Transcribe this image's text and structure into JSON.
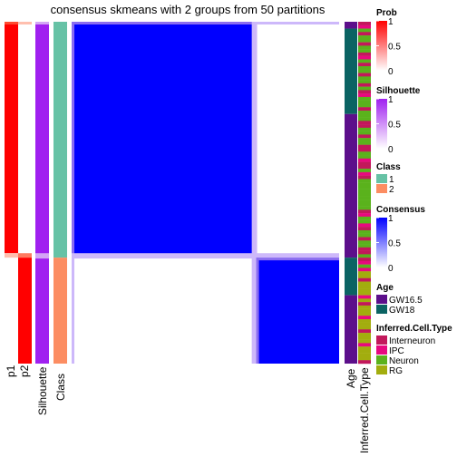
{
  "chart_data": {
    "type": "heatmap",
    "title": "consensus skmeans with 2 groups from 50 partitions",
    "n_samples": 100,
    "group_sizes": [
      69,
      31
    ],
    "columns": [
      "p1",
      "p2",
      "Silhouette",
      "Class"
    ],
    "right_annotations": [
      "Age",
      "Inferred.Cell.Type"
    ],
    "groups": [
      {
        "class": "1",
        "p1": 1.0,
        "p2": 0.0,
        "silhouette": 0.92,
        "consensus_within": 1.0,
        "consensus_between": 0.0
      },
      {
        "class": "2",
        "p1": 0.0,
        "p2": 1.0,
        "silhouette": 0.92,
        "consensus_within": 1.0,
        "consensus_between": 0.0
      }
    ],
    "boundary_values": {
      "p1_edge": 0.25,
      "p2_edge": 0.75,
      "silhouette_edge": 0.5,
      "consensus_edge": 0.35
    },
    "age_segments": [
      {
        "label": "GW16.5",
        "count": 2
      },
      {
        "label": "GW18",
        "count": 25
      },
      {
        "label": "GW16.5",
        "count": 42
      },
      {
        "label": "GW18",
        "count": 11
      },
      {
        "label": "GW16.5",
        "count": 20
      }
    ],
    "cell_type_pattern_group1": "Neuron-dominant with interspersed Interneuron and IPC stripes",
    "cell_type_pattern_group2": "RG-dominant with interspersed Interneuron and IPC stripes",
    "legends": [
      {
        "title": "Prob",
        "type": "continuous",
        "ticks": [
          "1",
          "0.5",
          "0"
        ],
        "colors": [
          "#ff0000",
          "#ffffff"
        ]
      },
      {
        "title": "Silhouette",
        "type": "continuous",
        "ticks": [
          "1",
          "0.5",
          "0"
        ],
        "colors": [
          "#a020f0",
          "#ffffff"
        ]
      },
      {
        "title": "Class",
        "type": "discrete",
        "items": [
          {
            "label": "1",
            "color": "#66c2a5"
          },
          {
            "label": "2",
            "color": "#fc8d62"
          }
        ]
      },
      {
        "title": "Consensus",
        "type": "continuous",
        "ticks": [
          "1",
          "0.5",
          "0"
        ],
        "colors": [
          "#0000ff",
          "#ffffff"
        ]
      },
      {
        "title": "Age",
        "type": "discrete",
        "items": [
          {
            "label": "GW16.5",
            "color": "#5c0f8b"
          },
          {
            "label": "GW18",
            "color": "#0b6363"
          }
        ]
      },
      {
        "title": "Inferred.Cell.Type",
        "type": "discrete",
        "items": [
          {
            "label": "Interneuron",
            "color": "#c2185b"
          },
          {
            "label": "IPC",
            "color": "#e8087f"
          },
          {
            "label": "Neuron",
            "color": "#5ab21c"
          },
          {
            "label": "RG",
            "color": "#a2ad0e"
          }
        ]
      }
    ]
  },
  "colors": {
    "prob": "#ff0000",
    "prob_light": "#ffbfae",
    "silhouette": "#a020f0",
    "silhouette_light": "#d4a6f5",
    "class1": "#66c2a5",
    "class2": "#fc8d62",
    "consensus": "#0000ff",
    "consensus_light": "#cdb8fa",
    "consensus_mid": "#8a6cf0",
    "age1": "#5c0f8b",
    "age2": "#0b6363",
    "interneuron": "#c2185b",
    "ipc": "#e8087f",
    "neuron": "#5ab21c",
    "rg": "#a2ad0e"
  }
}
